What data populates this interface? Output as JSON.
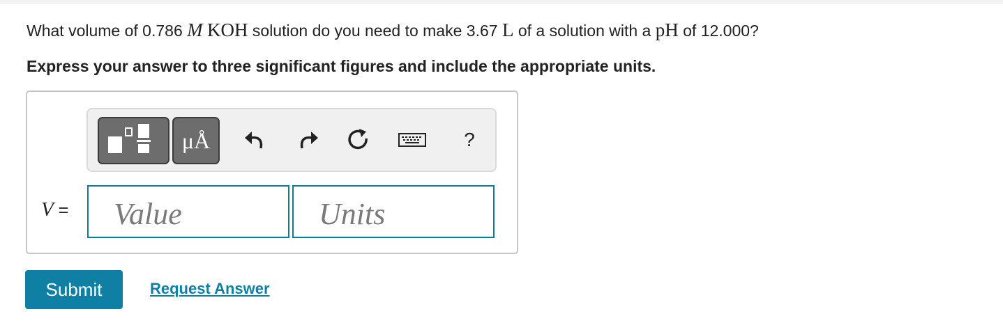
{
  "question": {
    "t1": "What volume of 0.786 ",
    "m": "M",
    "t2": " ",
    "koh": "KOH",
    "t3": " solution do you need to make 3.67 ",
    "L": "L",
    "t4": " of a solution with a ",
    "ph": "pH",
    "t5": " of 12.000?"
  },
  "instruction": "Express your answer to three significant figures and include the appropriate units.",
  "toolbar": {
    "units_label": "μÅ",
    "icons": [
      "templates-icon",
      "units-icon",
      "undo-icon",
      "redo-icon",
      "reset-icon",
      "keyboard-icon",
      "help-icon"
    ],
    "help_label": "?"
  },
  "answer": {
    "variable": "V",
    "equals": " =",
    "value_placeholder": "Value",
    "units_placeholder": "Units"
  },
  "buttons": {
    "submit": "Submit",
    "request_answer": "Request Answer"
  },
  "colors": {
    "accent": "#0f7fa3",
    "field_border": "#0b7c9a",
    "toolbar_button": "#6d6d6d"
  }
}
